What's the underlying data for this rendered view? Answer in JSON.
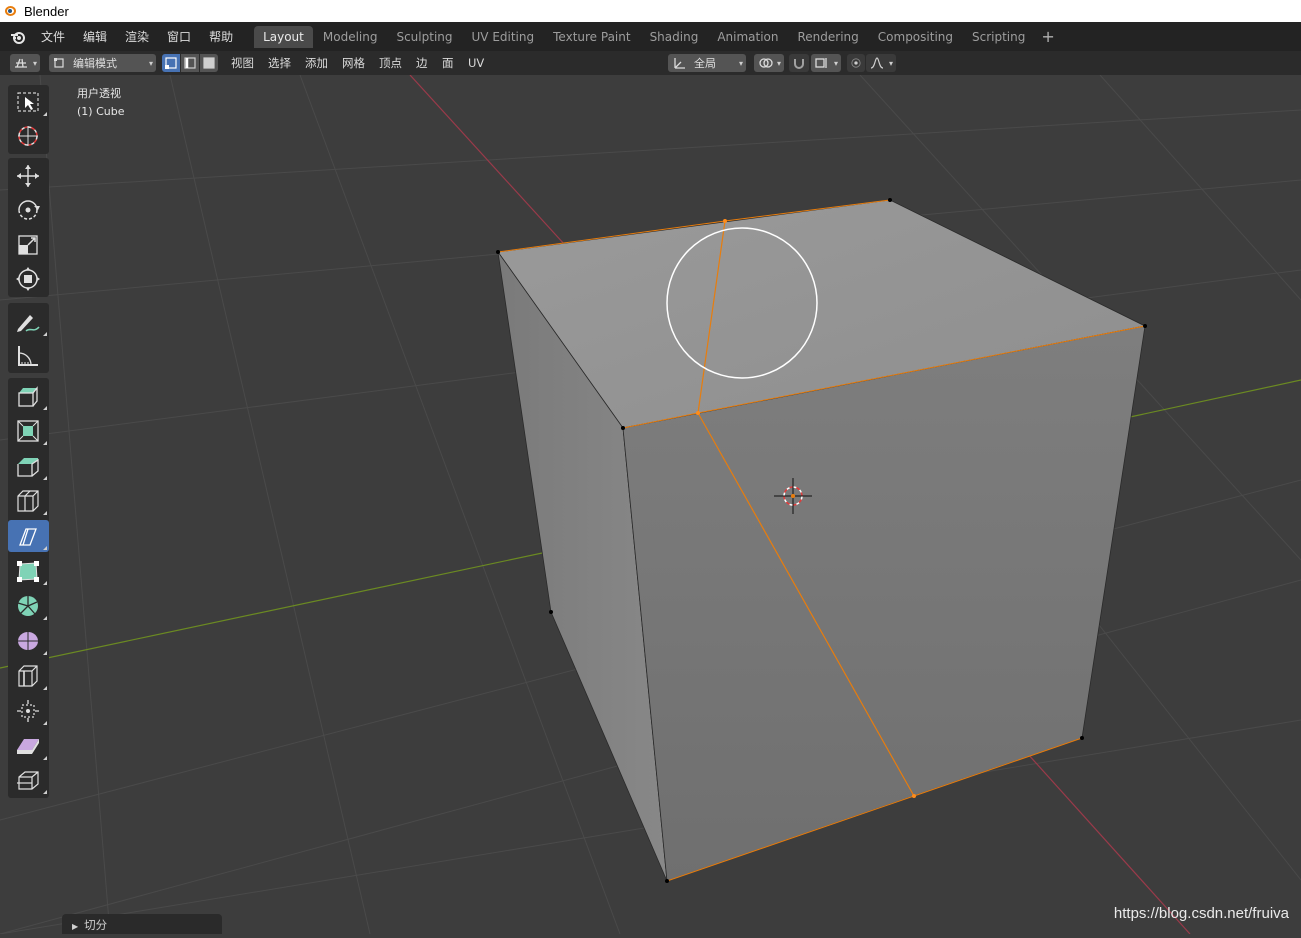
{
  "window": {
    "title": "Blender"
  },
  "menubar": {
    "items": [
      "文件",
      "编辑",
      "渲染",
      "窗口",
      "帮助"
    ],
    "tabs": [
      "Layout",
      "Modeling",
      "Sculpting",
      "UV Editing",
      "Texture Paint",
      "Shading",
      "Animation",
      "Rendering",
      "Compositing",
      "Scripting"
    ],
    "active_tab": "Layout",
    "add_tab_icon": "plus-icon"
  },
  "header": {
    "mode": "编辑模式",
    "menus": [
      "视图",
      "选择",
      "添加",
      "网格",
      "顶点",
      "边",
      "面",
      "UV"
    ],
    "transform_orientation": "全局"
  },
  "viewport": {
    "view_name": "用户透视",
    "object_name": "(1) Cube",
    "colors": {
      "background": "#3d3d3d",
      "grid": "#4a4a4a",
      "x_axis": "#9a3a4a",
      "y_axis": "#6b8a22",
      "selection": "#e87d0d",
      "active_tool": "#4772b3"
    }
  },
  "toolbar": {
    "tools": [
      "select-box-icon",
      "cursor-icon",
      "move-icon",
      "rotate-icon",
      "scale-icon",
      "transform-icon",
      "annotate-icon",
      "measure-icon",
      "extrude-icon",
      "inset-icon",
      "bevel-icon",
      "loop-cut-icon",
      "knife-icon",
      "poly-build-icon",
      "spin-icon",
      "smooth-icon",
      "edge-slide-icon",
      "shrink-fatten-icon",
      "shear-icon",
      "rip-icon"
    ],
    "active": "knife-icon"
  },
  "operator_panel": {
    "label": "切分"
  },
  "watermark": "https://blog.csdn.net/fruiva"
}
